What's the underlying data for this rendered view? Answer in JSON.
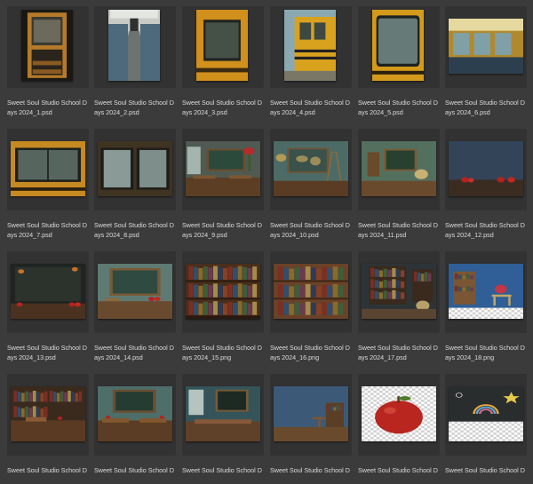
{
  "files": [
    {
      "name": "Sweet Soul Studio School Days 2024_1.psd",
      "scene": "bus-door",
      "orient": "portrait"
    },
    {
      "name": "Sweet Soul Studio School Days 2024_2.psd",
      "scene": "bus-aisle",
      "orient": "portrait"
    },
    {
      "name": "Sweet Soul Studio School Days 2024_3.psd",
      "scene": "bus-window",
      "orient": "portrait"
    },
    {
      "name": "Sweet Soul Studio School Days 2024_4.psd",
      "scene": "bus-side",
      "orient": "portrait"
    },
    {
      "name": "Sweet Soul Studio School Days 2024_5.psd",
      "scene": "bus-window-closeup",
      "orient": "portrait"
    },
    {
      "name": "Sweet Soul Studio School Days 2024_6.psd",
      "scene": "bus-interior-wide",
      "orient": "landscape"
    },
    {
      "name": "Sweet Soul Studio School Days 2024_7.psd",
      "scene": "bus-window-wide",
      "orient": "landscape"
    },
    {
      "name": "Sweet Soul Studio School Days 2024_8.psd",
      "scene": "bus-windows-pair",
      "orient": "landscape"
    },
    {
      "name": "Sweet Soul Studio School Days 2024_9.psd",
      "scene": "classroom-flowers",
      "orient": "landscape"
    },
    {
      "name": "Sweet Soul Studio School Days 2024_10.psd",
      "scene": "classroom-map",
      "orient": "landscape"
    },
    {
      "name": "Sweet Soul Studio School Days 2024_11.psd",
      "scene": "classroom-chalkboard-globe",
      "orient": "landscape"
    },
    {
      "name": "Sweet Soul Studio School Days 2024_12.psd",
      "scene": "blue-wall-apples",
      "orient": "landscape"
    },
    {
      "name": "Sweet Soul Studio School Days 2024_13.psd",
      "scene": "chalkboard-apples",
      "orient": "landscape"
    },
    {
      "name": "Sweet Soul Studio School Days 2024_14.psd",
      "scene": "framed-chalkboard",
      "orient": "landscape"
    },
    {
      "name": "Sweet Soul Studio School Days 2024_15.png",
      "scene": "bookshelf",
      "orient": "landscape"
    },
    {
      "name": "Sweet Soul Studio School Days 2024_16.png",
      "scene": "bookshelf-wood",
      "orient": "landscape"
    },
    {
      "name": "Sweet Soul Studio School Days 2024_17.psd",
      "scene": "library-globe",
      "orient": "landscape"
    },
    {
      "name": "Sweet Soul Studio School Days 2024_18.png",
      "scene": "blue-wall-shelf",
      "orient": "landscape"
    },
    {
      "name": "Sweet Soul Studio School D",
      "scene": "library-desks",
      "orient": "landscape"
    },
    {
      "name": "Sweet Soul Studio School D",
      "scene": "teal-chalkboard-desks",
      "orient": "landscape"
    },
    {
      "name": "Sweet Soul Studio School D",
      "scene": "classroom-window-desks",
      "orient": "landscape"
    },
    {
      "name": "Sweet Soul Studio School D",
      "scene": "blue-wall-desk",
      "orient": "landscape"
    },
    {
      "name": "Sweet Soul Studio School D",
      "scene": "apple-transparent",
      "orient": "landscape"
    },
    {
      "name": "Sweet Soul Studio School D",
      "scene": "chalk-doodles-transparent",
      "orient": "landscape"
    }
  ]
}
